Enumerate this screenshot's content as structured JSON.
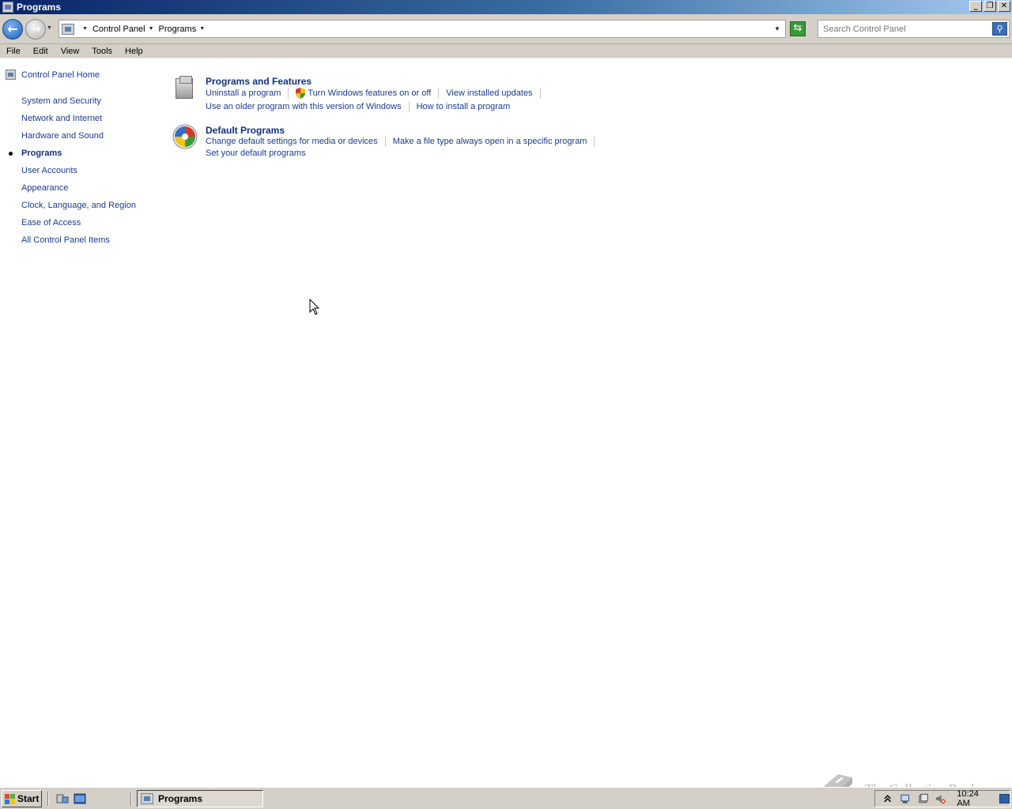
{
  "window": {
    "title": "Programs"
  },
  "window_buttons": {
    "minimize": "_",
    "restore": "❐",
    "close": "✕"
  },
  "address_bar": {
    "breadcrumbs": [
      "Control Panel",
      "Programs"
    ],
    "search_placeholder": "Search Control Panel"
  },
  "menu": [
    "File",
    "Edit",
    "View",
    "Tools",
    "Help"
  ],
  "sidebar": {
    "home_label": "Control Panel Home",
    "items": [
      {
        "label": "System and Security",
        "active": false
      },
      {
        "label": "Network and Internet",
        "active": false
      },
      {
        "label": "Hardware and Sound",
        "active": false
      },
      {
        "label": "Programs",
        "active": true
      },
      {
        "label": "User Accounts",
        "active": false
      },
      {
        "label": "Appearance",
        "active": false
      },
      {
        "label": "Clock, Language, and Region",
        "active": false
      },
      {
        "label": "Ease of Access",
        "active": false
      },
      {
        "label": "All Control Panel Items",
        "active": false
      }
    ]
  },
  "categories": {
    "programs_features": {
      "title": "Programs and Features",
      "links": {
        "uninstall": "Uninstall a program",
        "windows_features": "Turn Windows features on or off",
        "installed_updates": "View installed updates",
        "older_program": "Use an older program with this version of Windows",
        "how_install": "How to install a program"
      }
    },
    "default_programs": {
      "title": "Default Programs",
      "links": {
        "media_devices": "Change default settings for media or devices",
        "file_type": "Make a file type always open in a specific program",
        "set_defaults": "Set your default programs"
      }
    }
  },
  "taskbar": {
    "start_label": "Start",
    "task_button_label": "Programs",
    "clock": "10:24 AM"
  },
  "watermark": {
    "text": "The Collection Book"
  },
  "colors": {
    "link": "#1a3c8d",
    "heading_link": "#10307a",
    "chrome": "#d4d0c8",
    "title_gradient_start": "#0a246a"
  }
}
